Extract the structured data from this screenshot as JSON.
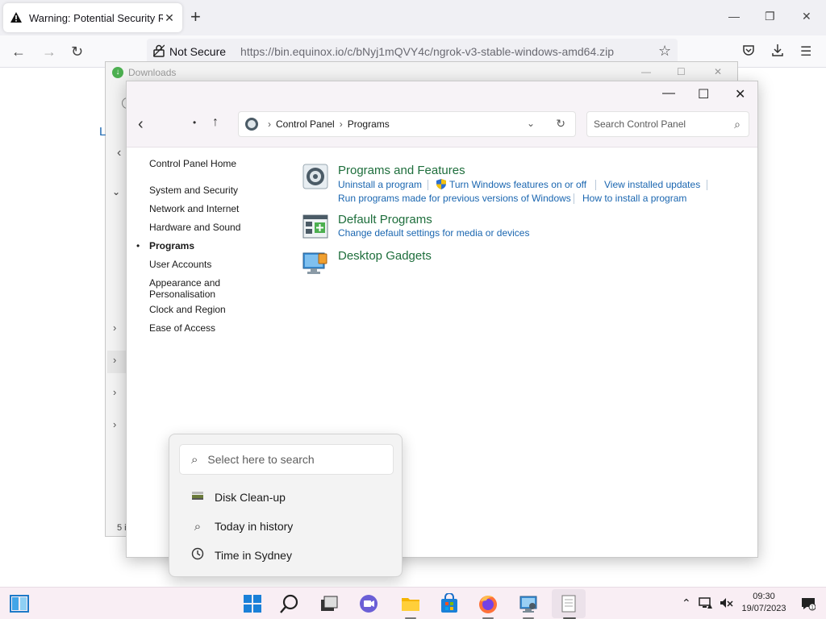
{
  "browser": {
    "tab_title": "Warning: Potential Security Risk",
    "new_tab": "+",
    "controls": {
      "minimize": "—",
      "maximize": "❐",
      "close": "✕"
    },
    "not_secure": "Not Secure",
    "url": "https://bin.equinox.io/c/bNyj1mQVY4c/ngrok-v3-stable-windows-amd64.zip"
  },
  "downloads": {
    "title": "Downloads",
    "side_letter": "L",
    "bottom_text": "5 i"
  },
  "control_panel": {
    "breadcrumb": [
      "Control Panel",
      "Programs"
    ],
    "search_placeholder": "Search Control Panel",
    "nav": {
      "home": "Control Panel Home",
      "items": [
        "System and Security",
        "Network and Internet",
        "Hardware and Sound",
        "Programs",
        "User Accounts",
        "Appearance and",
        "Personalisation",
        "Clock and Region",
        "Ease of Access"
      ],
      "bullet": "•"
    },
    "categories": {
      "programs_features": {
        "title": "Programs and Features",
        "links": [
          "Uninstall a program",
          "Turn Windows features on or off",
          "View installed updates",
          "Run programs made for previous versions of Windows",
          "How to install a program"
        ]
      },
      "default_programs": {
        "title": "Default Programs",
        "links": [
          "Change default settings for media or devices"
        ]
      },
      "desktop_gadgets": {
        "title": "Desktop Gadgets"
      }
    }
  },
  "search_flyout": {
    "placeholder": "Select here to search",
    "items": [
      "Disk Clean-up",
      "Today in history",
      "Time in Sydney"
    ]
  },
  "taskbar": {
    "time": "09:30",
    "date": "19/07/2023"
  }
}
